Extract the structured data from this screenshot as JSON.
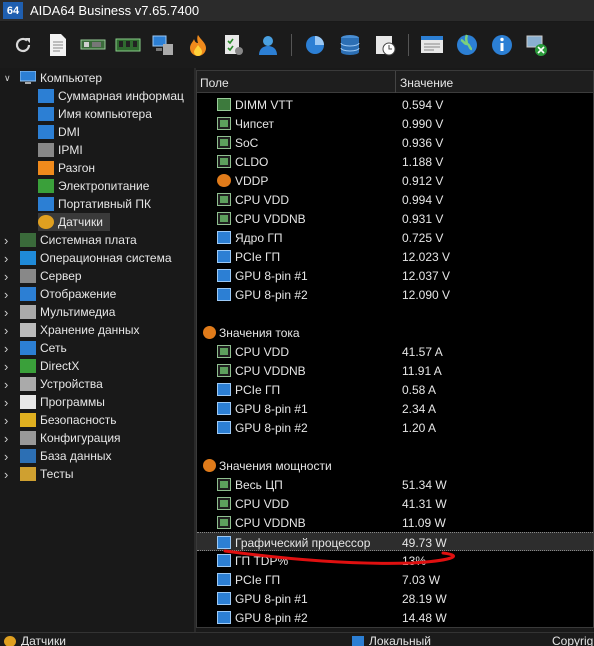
{
  "window": {
    "app_icon_text": "64",
    "title": "AIDA64 Business v7.65.7400"
  },
  "toolbar": {
    "buttons": [
      "refresh-icon",
      "report-icon",
      "motherboard-icon",
      "memory-icon",
      "computer-network-icon",
      "flame-icon",
      "checklist-icon",
      "user-icon",
      "chart-icon",
      "database-icon",
      "schedule-icon",
      "web-report-icon",
      "globe-icon",
      "info-icon",
      "exit-icon"
    ]
  },
  "tree": {
    "computer": {
      "label": "Компьютер",
      "children": [
        "Суммарная информац",
        "Имя компьютера",
        "DMI",
        "IPMI",
        "Разгон",
        "Электропитание",
        "Портативный ПК",
        "Датчики"
      ]
    },
    "sections": [
      "Системная плата",
      "Операционная система",
      "Сервер",
      "Отображение",
      "Мультимедиа",
      "Хранение данных",
      "Сеть",
      "DirectX",
      "Устройства",
      "Программы",
      "Безопасность",
      "Конфигурация",
      "База данных",
      "Тесты"
    ]
  },
  "grid": {
    "col_field": "Поле",
    "col_value": "Значение",
    "voltage_rows": [
      {
        "name": "DIMM VTT",
        "value": "0.594 V"
      },
      {
        "name": "Чипсет",
        "value": "0.990 V"
      },
      {
        "name": "SoC",
        "value": "0.936 V"
      },
      {
        "name": "CLDO",
        "value": "1.188 V"
      },
      {
        "name": "VDDP",
        "value": "0.912 V"
      },
      {
        "name": "CPU VDD",
        "value": "0.994 V"
      },
      {
        "name": "CPU VDDNB",
        "value": "0.931 V"
      },
      {
        "name": "Ядро ГП",
        "value": "0.725 V"
      },
      {
        "name": "PCIe ГП",
        "value": "12.023 V"
      },
      {
        "name": "GPU 8-pin #1",
        "value": "12.037 V"
      },
      {
        "name": "GPU 8-pin #2",
        "value": "12.090 V"
      }
    ],
    "current_group": "Значения тока",
    "current_rows": [
      {
        "name": "CPU VDD",
        "value": "41.57 A"
      },
      {
        "name": "CPU VDDNB",
        "value": "11.91 A"
      },
      {
        "name": "PCIe ГП",
        "value": "0.58 A"
      },
      {
        "name": "GPU 8-pin #1",
        "value": "2.34 A"
      },
      {
        "name": "GPU 8-pin #2",
        "value": "1.20 A"
      }
    ],
    "power_group": "Значения мощности",
    "power_rows": [
      {
        "name": "Весь ЦП",
        "value": "51.34 W"
      },
      {
        "name": "CPU VDD",
        "value": "41.31 W"
      },
      {
        "name": "CPU VDDNB",
        "value": "11.09 W"
      },
      {
        "name": "Графический процессор",
        "value": "49.73 W"
      },
      {
        "name": "ГП TDP%",
        "value": "13%"
      },
      {
        "name": "PCIe ГП",
        "value": "7.03 W"
      },
      {
        "name": "GPU 8-pin #1",
        "value": "28.19 W"
      },
      {
        "name": "GPU 8-pin #2",
        "value": "14.48 W"
      }
    ]
  },
  "statusbar": {
    "left": "Датчики",
    "middle": "Локальный",
    "right": "Copyrig"
  },
  "colors": {
    "annotation": "#e01010",
    "selection": "#2d2d2d"
  }
}
